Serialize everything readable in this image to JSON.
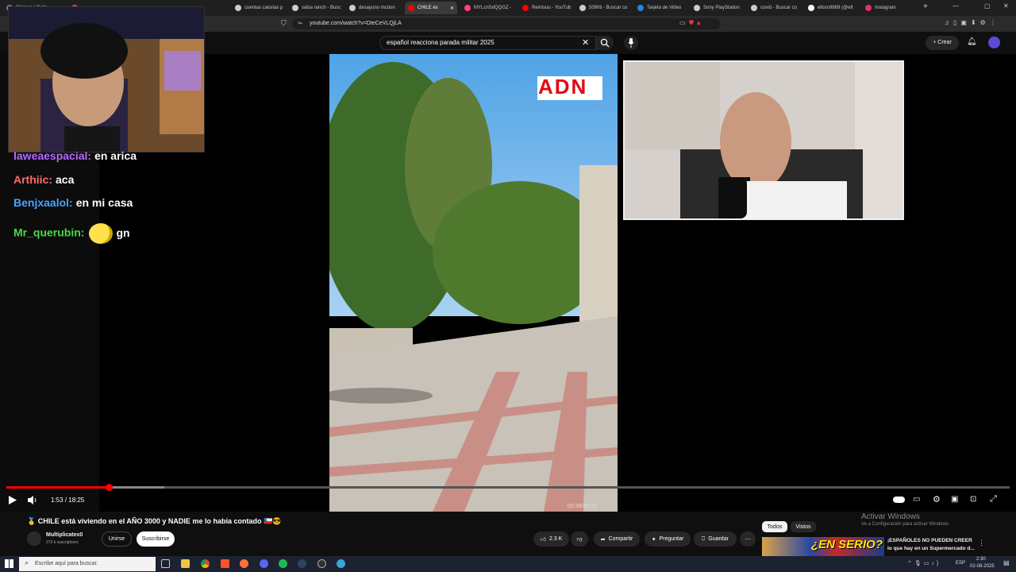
{
  "browser": {
    "tabs": [
      {
        "label": "Stickers | Ballo",
        "color": "#9b59b6"
      },
      {
        "label": "",
        "color": "#e74c3c"
      },
      {
        "label": "cuentas calorias p",
        "color": "#cccccc"
      },
      {
        "label": "salsa ranch - Busc",
        "color": "#cccccc"
      },
      {
        "label": "desayuno mcdon",
        "color": "#cccccc"
      },
      {
        "label": "CHILE es",
        "color": "#ff0000"
      },
      {
        "label": "MYLcnSdQQGZ -",
        "color": "#ff4081"
      },
      {
        "label": "Reimsuu - YouTub",
        "color": "#ff0000"
      },
      {
        "label": "5090ti - Buscar co",
        "color": "#cccccc"
      },
      {
        "label": "Tarjeta de Video",
        "color": "#1e88e5"
      },
      {
        "label": "Sony PlayStation",
        "color": "#cccccc"
      },
      {
        "label": "covid - Buscar co",
        "color": "#cccccc"
      },
      {
        "label": "eltoro9669 (@elt",
        "color": "#ffffff"
      },
      {
        "label": "Instagram",
        "color": "#e1306c"
      }
    ],
    "url": "youtube.com/watch?v=DteCeVLQjLA"
  },
  "youtube": {
    "search_value": "español reacciona parada militar 2025",
    "create_label": "Crear"
  },
  "chat": [
    {
      "user": "laweaespacial:",
      "msg": "en arica",
      "color": "#b46cff"
    },
    {
      "user": "Arthiic:",
      "msg": "aca",
      "color": "#ff6b6b"
    },
    {
      "user": "Benjxaalol:",
      "msg": "en mi casa",
      "color": "#4aa3ff"
    },
    {
      "user": "Mr_querubin:",
      "msg": "gn",
      "color": "#48d948"
    }
  ],
  "video": {
    "logo": "ADN",
    "overlay_time": "00:36/00:39"
  },
  "player": {
    "time": "1:53 / 18:25",
    "progress_fraction": 0.1023
  },
  "meta": {
    "title": "🥇 CHILE está viviendo en el AÑO 3000 y NADIE me lo había contado 🇨🇱😎",
    "channel": "Multiplicatex0",
    "subscribers": "273 k suscriptores",
    "join_label": "Unirse",
    "subscribe_label": "Suscribirse",
    "likes": "2.3 K",
    "share_label": "Compartir",
    "ask_label": "Preguntar",
    "save_label": "Guardar",
    "chip_all": "Todos",
    "chip_watched": "Vistos"
  },
  "recommended": {
    "thumb_text": "¿EN SERIO?",
    "title_line1": "¡ESPAÑOLES NO PUEDEN CREER",
    "title_line2": "lo que hay en un Supermercado d..."
  },
  "watermark": {
    "line1": "Activar Windows",
    "line2": "Ve a Configuración para activar Windows."
  },
  "taskbar": {
    "search_placeholder": "Escribe aquí para buscar.",
    "lang": "ESP",
    "time": "2:30",
    "date": "02-08-2025"
  }
}
